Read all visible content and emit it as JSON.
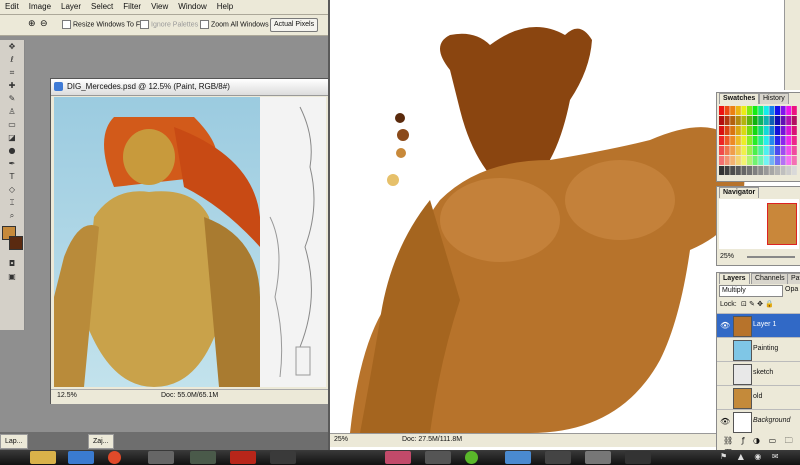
{
  "menu": [
    "Edit",
    "Image",
    "Layer",
    "Select",
    "Filter",
    "View",
    "Window",
    "Help"
  ],
  "options": {
    "resize_windows": "Resize Windows To Fit",
    "ignore_palettes": "Ignore Palettes",
    "zoom_all": "Zoom All Windows",
    "actual_pixels": "Actual Pixels"
  },
  "document": {
    "title": "DIG_Mercedes.psd @ 12.5% (Paint, RGB/8#)",
    "zoom": "12.5%",
    "doc_size": "Doc: 55.0M/65.1M"
  },
  "taskbar_tabs": [
    "Lap...",
    "Zaj..."
  ],
  "right_document": {
    "zoom": "25%",
    "doc_size": "Doc: 27.5M/111.8M"
  },
  "swatches": {
    "tab_active": "Swatches",
    "tab_other": "History"
  },
  "navigator": {
    "title": "Navigator",
    "zoom": "25%"
  },
  "layers_panel": {
    "tabs": [
      "Layers",
      "Channels",
      "Paths"
    ],
    "blend_mode": "Multiply",
    "opacity_label": "Opa",
    "lock_label": "Lock:",
    "layers": [
      {
        "name": "Layer 1",
        "active": true,
        "visible": true
      },
      {
        "name": "Painting",
        "active": false,
        "visible": false
      },
      {
        "name": "sketch",
        "active": false,
        "visible": false
      },
      {
        "name": "old",
        "active": false,
        "visible": false
      },
      {
        "name": "Background",
        "active": false,
        "visible": true
      }
    ]
  },
  "colors": {
    "ps_chrome": "#ece9d8",
    "skin": "#b7732b",
    "layer_active": "#3169c6",
    "taskbar": "#1a1a1a"
  }
}
